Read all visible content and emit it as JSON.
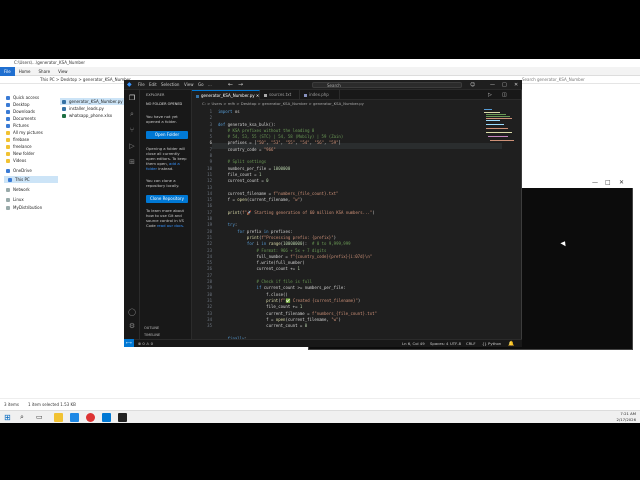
{
  "explorer": {
    "title_path": "C:\\Users\\...\\generator_KSA_Number",
    "ribbon": [
      "File",
      "Home",
      "Share",
      "View"
    ],
    "address": "This PC  >  Desktop  >  generator_KSA_Number",
    "search_hint": "Search generator_KSA_Number",
    "nav": [
      {
        "label": "Quick access",
        "kind": "blue"
      },
      {
        "label": "Desktop",
        "kind": "blue"
      },
      {
        "label": "Downloads",
        "kind": "blue"
      },
      {
        "label": "Documents",
        "kind": "blue"
      },
      {
        "label": "Pictures",
        "kind": "blue"
      },
      {
        "label": "All my pictures",
        "kind": "folder"
      },
      {
        "label": "firebase",
        "kind": "folder"
      },
      {
        "label": "freelance",
        "kind": "folder"
      },
      {
        "label": "New folder",
        "kind": "folder"
      },
      {
        "label": "Videos",
        "kind": "folder"
      },
      {
        "label": "OneDrive",
        "kind": "blue"
      },
      {
        "label": "This PC",
        "kind": "sel"
      },
      {
        "label": "Network",
        "kind": "gray"
      },
      {
        "label": "Linux",
        "kind": "gray"
      },
      {
        "label": "MyDistribution",
        "kind": "gray"
      }
    ],
    "files": [
      "generator_KSA_Number.py",
      "installer_leads.py",
      "whatsapp_phone.xlsx"
    ],
    "status_items": "3 items",
    "status_selected": "1 item selected  1.53 KB"
  },
  "vscode": {
    "menu": [
      "File",
      "Edit",
      "Selection",
      "View",
      "Go",
      "..."
    ],
    "search": "Search",
    "explorer_head": "EXPLORER",
    "no_folder_head": "NO FOLDER OPENED",
    "no_folder_text": "You have not yet opened a folder.",
    "open_folder_btn": "Open Folder",
    "info_text": "Opening a folder will close all currently open editors. To keep them open,",
    "info_link": "add a folder",
    "info_tail": "instead.",
    "clone_text": "You can clone a repository locally.",
    "clone_btn": "Clone Repository",
    "git_text": "To learn more about how to use Git and source control in VS Code",
    "git_link": "read our docs.",
    "outline": "OUTLINE",
    "timeline": "TIMELINE",
    "tabs": [
      "generator_KSA_Number.py",
      "sources.txt",
      "index.php"
    ],
    "breadcrumb": "C: > Users > mfh > Desktop > generator_KSA_Number > generator_KSA_Number.py",
    "status_errors": "⊗ 0 ⚠ 0",
    "status_pos": "Ln 6, Col 49",
    "status_spaces": "Spaces: 4",
    "status_enc": "UTF-8",
    "status_eol": "CRLF",
    "status_lang": "{} Python",
    "line_numbers": [
      "1",
      "2",
      "3",
      "4",
      "5",
      "6",
      "7",
      "8",
      "9",
      "10",
      "11",
      "12",
      "13",
      "14",
      "15",
      "16",
      "17",
      "18",
      "19",
      "20",
      "21",
      "22",
      "23",
      "24",
      "25",
      "26",
      "27",
      "28",
      "29",
      "30",
      "31",
      "32",
      "33",
      "34",
      "35"
    ],
    "code_lines": [
      "import os",
      "",
      "def generate_ksa_bulk():",
      "    # KSA prefixes without the leading 0",
      "    # 54, 53, 55 (STC) | 54, 58 (Mobily) | 59 (Zain)",
      "    prefixes = [\"50\", \"53\", \"55\", \"54\", \"56\", \"59\"]",
      "    country_code = \"966\"",
      "",
      "    # Split settings",
      "    numbers_per_file = 1000000",
      "    file_count = 1",
      "    current_count = 0",
      "",
      "    current_filename = f\"numbers_{file_count}.txt\"",
      "    f = open(current_filename, \"w\")",
      "",
      "    print(f\"🚀 Starting generation of 60 million KSA numbers...\")",
      "",
      "    try:",
      "        for prefix in prefixes:",
      "            print(f\"Processing prefix: {prefix}\")",
      "            for i in range(10000000):  # 0 to 9,999,999",
      "                # Format: 966 + 5x + 7 digits",
      "                full_number = f\"{country_code}{prefix}{i:07d}\\n\"",
      "                f.write(full_number)",
      "                current_count += 1",
      "",
      "                # Check if file is full",
      "                if current_count >= numbers_per_file:",
      "                    f.close()",
      "                    print(f\"✅ Created {current_filename}\")",
      "                    file_count += 1",
      "                    current_filename = f\"numbers_{file_count}.txt\"",
      "                    f = open(current_filename, \"w\")",
      "                    current_count = 0",
      "",
      "    finally:"
    ]
  },
  "console": {
    "ctrl_min": "—",
    "ctrl_max": "□",
    "ctrl_close": "✕"
  },
  "taskbar": {
    "time": "7:21 AM",
    "date": "2/17/2026"
  },
  "colors": {
    "accent": "#0078d4",
    "editor_bg": "#1f1f1f",
    "keyword": "#569cd6",
    "string": "#ce9178",
    "comment": "#6a9955"
  }
}
